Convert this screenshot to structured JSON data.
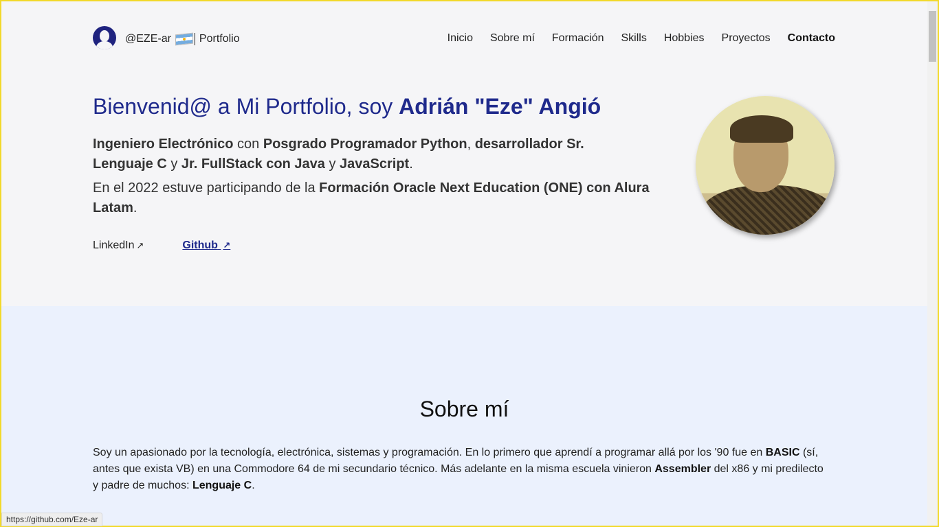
{
  "header": {
    "brand_handle": "@EZE-ar",
    "brand_suffix": "Portfolio",
    "nav": [
      {
        "label": "Inicio"
      },
      {
        "label": "Sobre mí"
      },
      {
        "label": "Formación"
      },
      {
        "label": "Skills"
      },
      {
        "label": "Hobbies"
      },
      {
        "label": "Proyectos"
      },
      {
        "label": "Contacto"
      }
    ]
  },
  "hero": {
    "title_prefix": "Bienvenid@ a Mi Portfolio, soy ",
    "title_name": "Adrián \"Eze\" Angió",
    "p1": {
      "b1": "Ingeniero Electrónico",
      "t1": " con ",
      "b2": "Posgrado Programador Python",
      "t2": ", ",
      "b3": "desarrollador Sr. Lenguaje C",
      "t3": " y ",
      "b4": "Jr. FullStack con Java",
      "t4": " y ",
      "b5": "JavaScript",
      "t5": "."
    },
    "p2": {
      "t1": "En el 2022 estuve participando de la ",
      "b1": "Formación Oracle Next Education (ONE) con Alura Latam",
      "t2": "."
    },
    "links": {
      "linkedin": "LinkedIn",
      "github": "Github",
      "arrow": "↗"
    }
  },
  "about": {
    "title": "Sobre mí",
    "t1": "Soy un apasionado por la tecnología, electrónica, sistemas y programación. En lo primero que aprendí a programar allá por los '90 fue en ",
    "b1": "BASIC",
    "t2": " (sí, antes que exista VB) en una Commodore 64 de mi secundario técnico. Más adelante en la misma escuela vinieron ",
    "b2": "Assembler",
    "t3": " del x86 y mi predilecto y padre de muchos: ",
    "b3": "Lenguaje C",
    "t4": "."
  },
  "status_bar": {
    "url": "https://github.com/Eze-ar"
  },
  "colors": {
    "accent": "#1f2a8c",
    "hero_bg": "#f5f5f7",
    "about_bg": "#ebf1fd"
  }
}
